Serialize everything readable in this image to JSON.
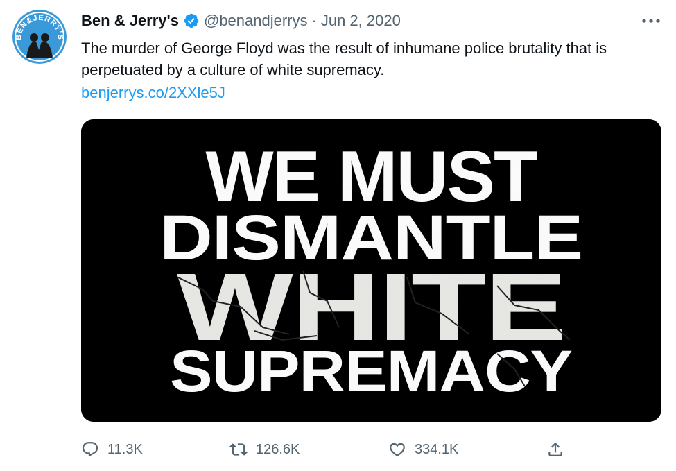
{
  "tweet": {
    "author": {
      "display_name": "Ben & Jerry's",
      "handle": "@benandjerrys",
      "verified": true,
      "avatar_text": "BEN&JERRY'S"
    },
    "separator": "·",
    "date": "Jun 2, 2020",
    "text": "The murder of George Floyd was the result of inhumane police brutality that is perpetuated by a culture of white supremacy.",
    "link": "benjerrys.co/2XXle5J",
    "media": {
      "lines": [
        "WE MUST",
        "DISMANTLE",
        "WHITE",
        "SUPREMACY"
      ],
      "background": "#000000",
      "text_color": "#ffffff"
    },
    "stats": {
      "replies": "11.3K",
      "retweets": "126.6K",
      "likes": "334.1K"
    },
    "icons": {
      "more": "more-horizontal-icon",
      "reply": "reply-icon",
      "retweet": "retweet-icon",
      "like": "heart-icon",
      "share": "share-icon",
      "verified": "verified-badge-icon"
    }
  },
  "colors": {
    "text": "#0f1419",
    "secondary": "#536471",
    "link": "#1d9bf0",
    "avatar_bg": "#3a9ad9"
  }
}
